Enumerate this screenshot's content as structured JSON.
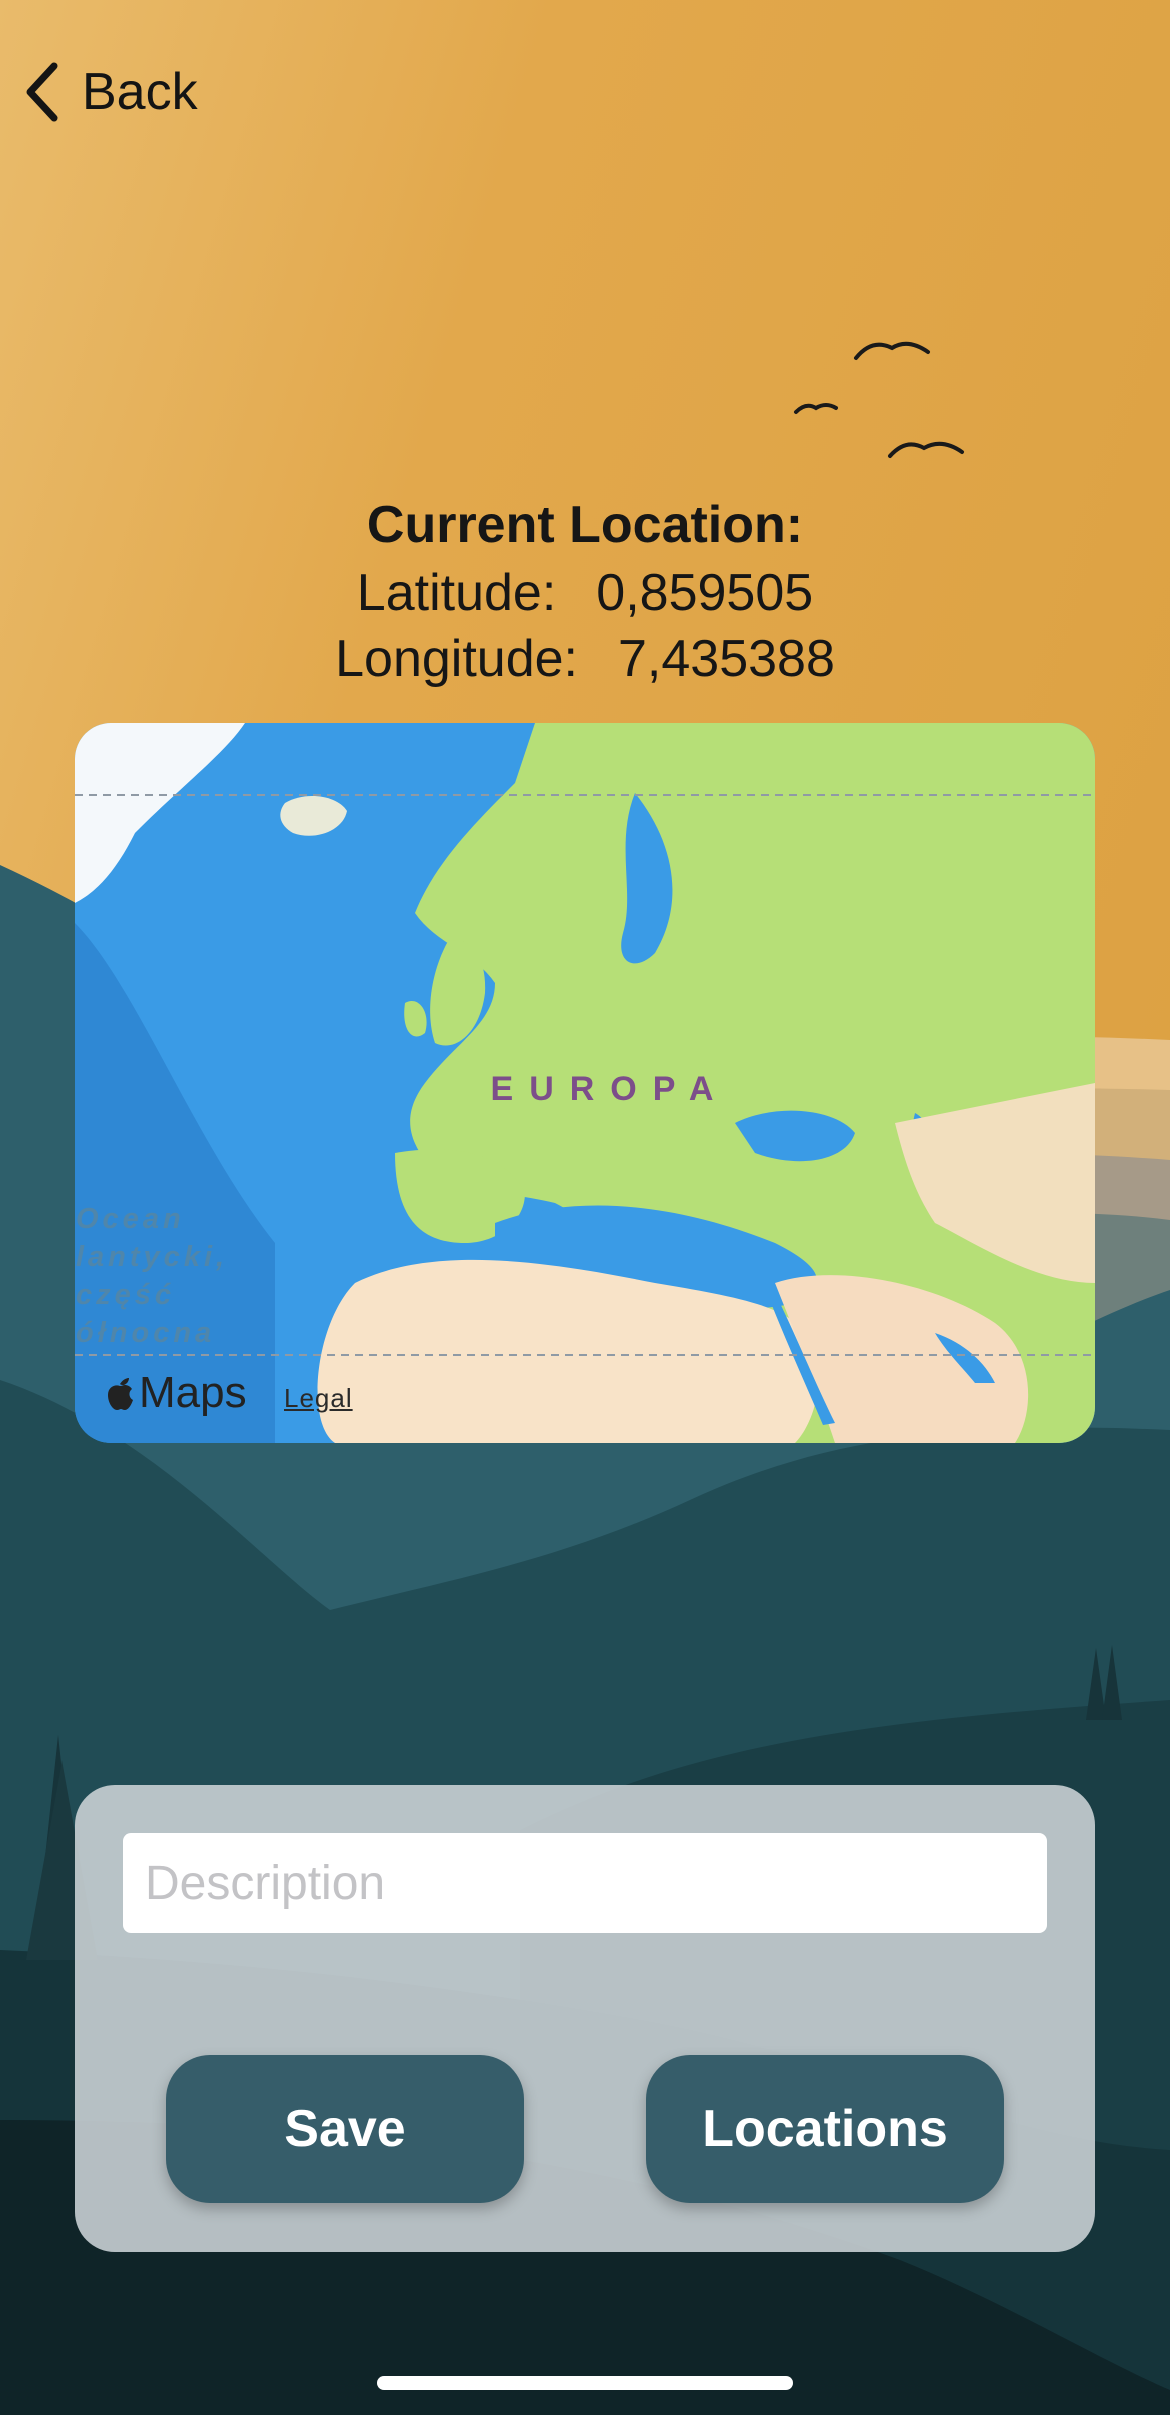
{
  "nav": {
    "back_label": "Back"
  },
  "location": {
    "title": "Current Location:",
    "latitude_label": "Latitude:",
    "latitude_value": "0,859505",
    "longitude_label": "Longitude:",
    "longitude_value": "7,435388"
  },
  "map": {
    "region_label": "EUROPA",
    "ocean_label_lines": [
      "Ocean",
      "lantycki,",
      "część",
      "ółnocna"
    ],
    "brand_label": "Maps",
    "legal_label": "Legal"
  },
  "form": {
    "description_placeholder": "Description"
  },
  "buttons": {
    "save_label": "Save",
    "locations_label": "Locations"
  },
  "colors": {
    "sky_top": "#e2a446",
    "mountain_far": "#2e5f6b",
    "mountain_mid": "#214c55",
    "ground_dark": "#0f2428",
    "button": "#365d6a",
    "map_ocean": "#3a9be6",
    "map_land": "#b6df77",
    "map_desert": "#f8e3c8"
  }
}
